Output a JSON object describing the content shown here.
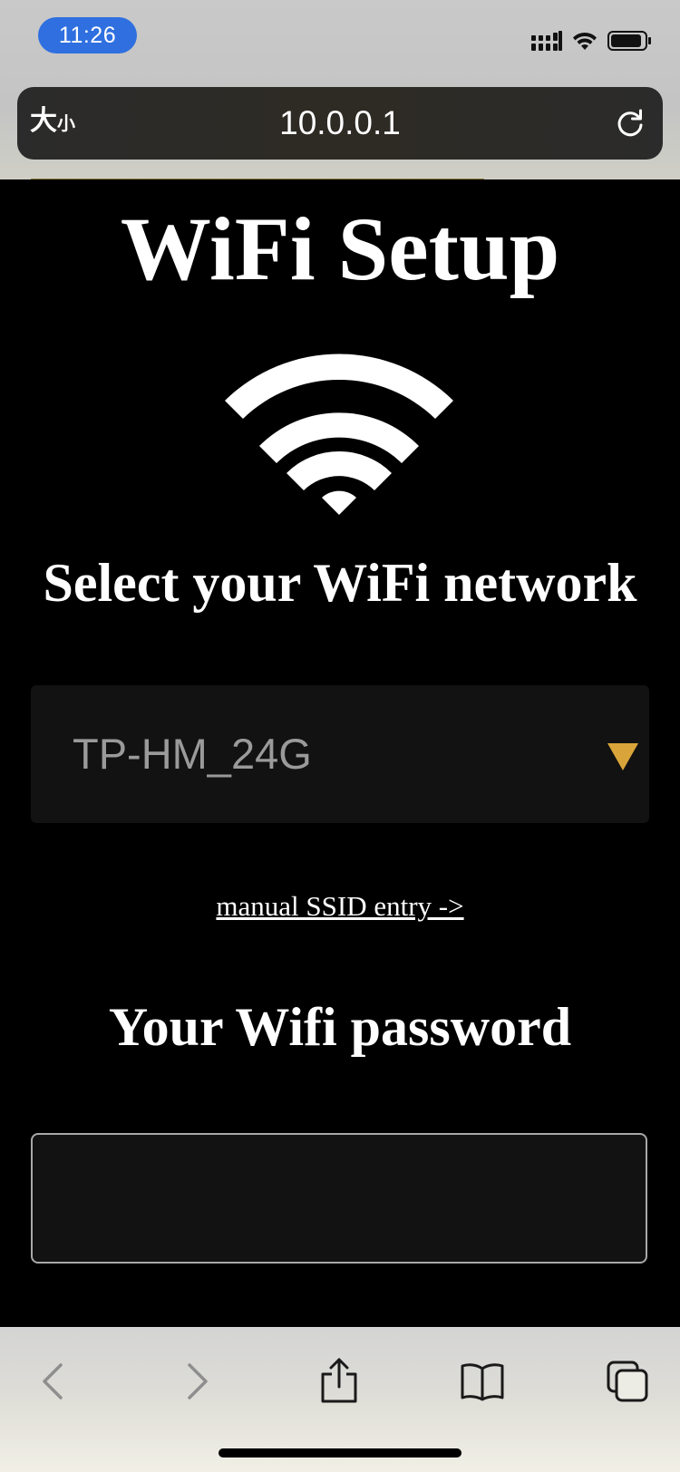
{
  "status_bar": {
    "time": "11:26"
  },
  "address_bar": {
    "text_size_big": "大",
    "text_size_small": "小",
    "url": "10.0.0.1"
  },
  "page": {
    "title": "WiFi Setup",
    "select_heading": "Select your WiFi network",
    "selected_network": "TP-HM_24G",
    "manual_link": "manual SSID entry ->",
    "password_heading": "Your Wifi password",
    "password_value": ""
  },
  "colors": {
    "accent_gold": "#d9a53a",
    "time_pill": "#2f6fe0",
    "page_background": "#000000"
  },
  "icons": {
    "wifi": "wifi-icon",
    "dropdown": "triangle-down-icon",
    "reload": "reload-icon",
    "back": "chevron-left-icon",
    "forward": "chevron-right-icon",
    "share": "share-icon",
    "bookmarks": "book-icon",
    "tabs": "tabs-icon"
  }
}
